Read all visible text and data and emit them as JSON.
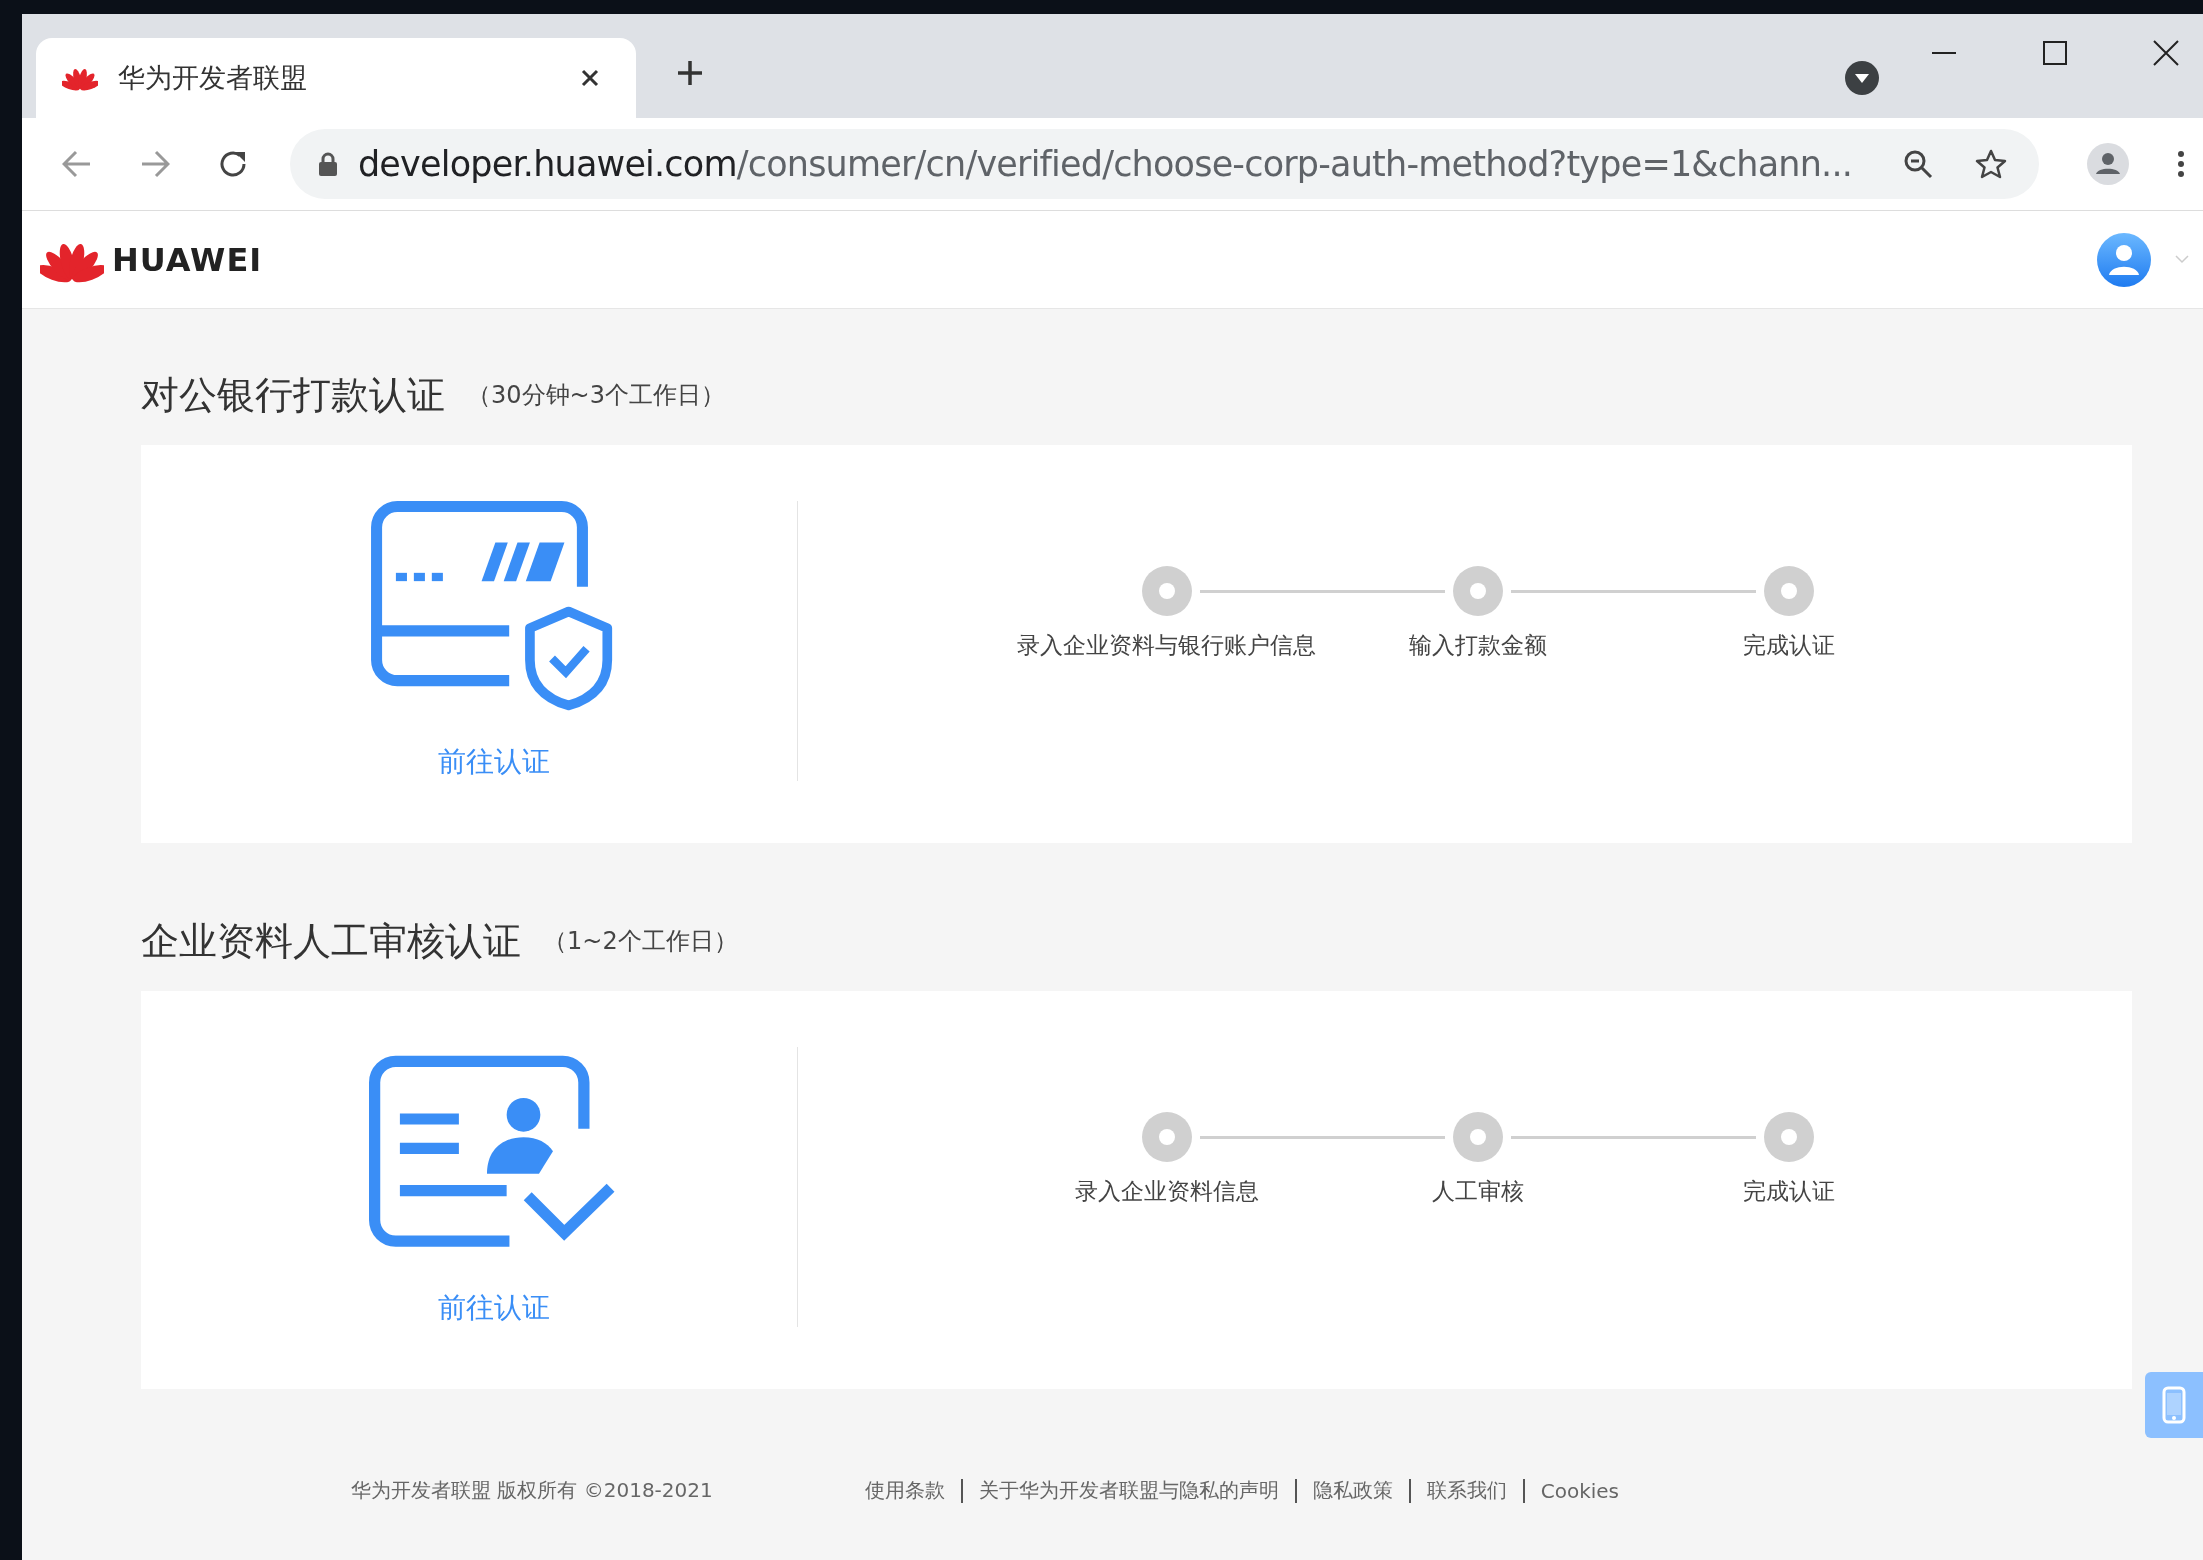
{
  "browser": {
    "tab": {
      "title": "华为开发者联盟"
    },
    "address": {
      "domain": "developer.huawei.com",
      "path": "/consumer/cn/verified/choose-corp-auth-method?type=1&chann..."
    }
  },
  "header": {
    "logo_text": "HUAWEI"
  },
  "methods": [
    {
      "kind": "bank",
      "title": "对公银行打款认证",
      "duration": "（30分钟~3个工作日）",
      "link": "前往认证",
      "steps": [
        "录入企业资料与银行账户信息",
        "输入打款金额",
        "完成认证"
      ]
    },
    {
      "kind": "manual",
      "title": "企业资料人工审核认证",
      "duration": "（1~2个工作日）",
      "link": "前往认证",
      "steps": [
        "录入企业资料信息",
        "人工审核",
        "完成认证"
      ]
    }
  ],
  "footer": {
    "copyright": "华为开发者联盟 版权所有 ©2018-2021",
    "links": [
      "使用条款",
      "关于华为开发者联盟与隐私的声明",
      "隐私政策",
      "联系我们",
      "Cookies"
    ]
  }
}
